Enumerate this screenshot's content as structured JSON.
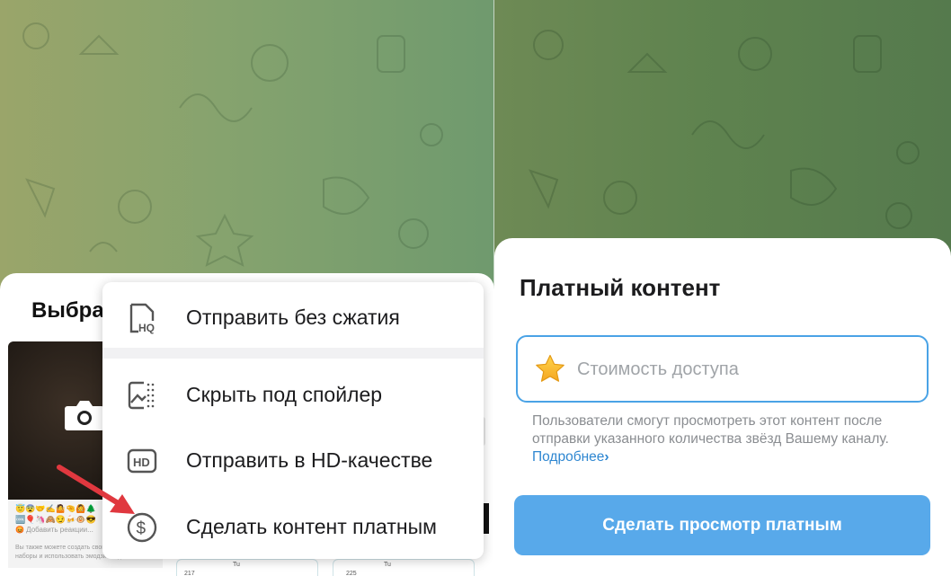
{
  "left_panel": {
    "sheet_title": "Выбрать",
    "emoji_rows": [
      "😇😨🤝✍️🤷🤏🙆🌲",
      "🆒🎈🦄🙈😏🍻🐵😎",
      "😡 Добавить реакции..."
    ],
    "mini_text": [
      "Вы также можете создать свой",
      "наборы и использовать эмодзи везде."
    ],
    "mini_link": "создать",
    "cards": [
      {
        "num": "217",
        "label": "Tu"
      },
      {
        "num": "225",
        "label": "Tu"
      }
    ],
    "menu": {
      "items": [
        {
          "label": "Отправить без сжатия",
          "icon": "hq-file-icon"
        },
        {
          "label": "Скрыть под спойлер",
          "icon": "spoiler-image-icon"
        },
        {
          "label": "Отправить в HD-качестве",
          "icon": "hd-icon"
        },
        {
          "label": "Сделать контент платным",
          "icon": "dollar-circle-icon"
        }
      ]
    },
    "arrow_color": "#e0383f"
  },
  "right_panel": {
    "title": "Платный контент",
    "price_placeholder": "Стоимость доступа",
    "price_value": "",
    "hint_text": "Пользователи смогут просмотреть этот контент после отправки указанного количества звёзд Вашему каналу.",
    "hint_link": "Подробнее",
    "hint_link_chevron": "›",
    "submit_label": "Сделать просмотр платным",
    "accent_color": "#4aa3e6",
    "button_color": "#58a9ea"
  }
}
